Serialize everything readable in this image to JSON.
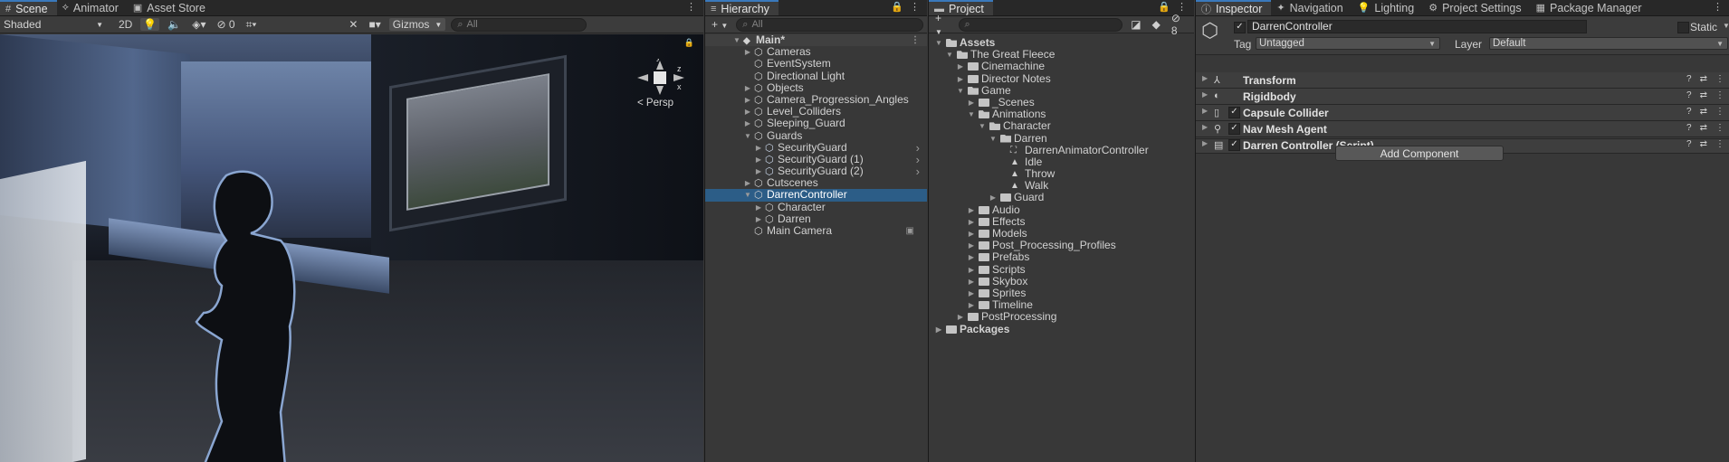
{
  "scene": {
    "tabs": [
      {
        "label": "Scene",
        "icon": "grid-icon"
      },
      {
        "label": "Animator",
        "icon": "animator-icon"
      },
      {
        "label": "Asset Store",
        "icon": "store-icon"
      }
    ],
    "shading_mode": "Shaded",
    "mode_2d": "2D",
    "hidden_count": "0",
    "gizmos_label": "Gizmos",
    "search_placeholder": "All",
    "projection_label": "Persp",
    "gizmo_axes": {
      "y": "y",
      "z": "z",
      "x": "x"
    }
  },
  "hierarchy": {
    "tab_label": "Hierarchy",
    "add_label": "+",
    "search_placeholder": "All",
    "scene_name": "Main*",
    "items": [
      {
        "label": "Cameras",
        "depth": 1,
        "arrow": "closed"
      },
      {
        "label": "EventSystem",
        "depth": 1,
        "arrow": "none"
      },
      {
        "label": "Directional Light",
        "depth": 1,
        "arrow": "none"
      },
      {
        "label": "Objects",
        "depth": 1,
        "arrow": "closed"
      },
      {
        "label": "Camera_Progression_Angles",
        "depth": 1,
        "arrow": "closed"
      },
      {
        "label": "Level_Colliders",
        "depth": 1,
        "arrow": "closed"
      },
      {
        "label": "Sleeping_Guard",
        "depth": 1,
        "arrow": "closed"
      },
      {
        "label": "Guards",
        "depth": 1,
        "arrow": "open"
      },
      {
        "label": "SecurityGuard",
        "depth": 2,
        "arrow": "closed",
        "prefab": true
      },
      {
        "label": "SecurityGuard (1)",
        "depth": 2,
        "arrow": "closed",
        "prefab": true
      },
      {
        "label": "SecurityGuard (2)",
        "depth": 2,
        "arrow": "closed",
        "prefab": true
      },
      {
        "label": "Cutscenes",
        "depth": 1,
        "arrow": "closed"
      },
      {
        "label": "DarrenController",
        "depth": 1,
        "arrow": "open",
        "selected": true
      },
      {
        "label": "Character",
        "depth": 2,
        "arrow": "closed"
      },
      {
        "label": "Darren",
        "depth": 2,
        "arrow": "closed"
      },
      {
        "label": "Main Camera",
        "depth": 1,
        "arrow": "none",
        "badge": "camera-icon"
      }
    ]
  },
  "project": {
    "tab_label": "Project",
    "add_label": "+",
    "hidden_count": "8",
    "items": [
      {
        "label": "Assets",
        "depth": 0,
        "arrow": "open",
        "kind": "folder",
        "bold": true
      },
      {
        "label": "The Great Fleece",
        "depth": 1,
        "arrow": "open",
        "kind": "folder"
      },
      {
        "label": "Cinemachine",
        "depth": 2,
        "arrow": "closed",
        "kind": "folder"
      },
      {
        "label": "Director Notes",
        "depth": 2,
        "arrow": "closed",
        "kind": "folder"
      },
      {
        "label": "Game",
        "depth": 2,
        "arrow": "open",
        "kind": "folder"
      },
      {
        "label": "_Scenes",
        "depth": 3,
        "arrow": "closed",
        "kind": "folder"
      },
      {
        "label": "Animations",
        "depth": 3,
        "arrow": "open",
        "kind": "folder"
      },
      {
        "label": "Character",
        "depth": 4,
        "arrow": "open",
        "kind": "folder"
      },
      {
        "label": "Darren",
        "depth": 5,
        "arrow": "open",
        "kind": "folder"
      },
      {
        "label": "DarrenAnimatorController",
        "depth": 6,
        "arrow": "none",
        "kind": "controller"
      },
      {
        "label": "Idle",
        "depth": 6,
        "arrow": "none",
        "kind": "anim"
      },
      {
        "label": "Throw",
        "depth": 6,
        "arrow": "none",
        "kind": "anim"
      },
      {
        "label": "Walk",
        "depth": 6,
        "arrow": "none",
        "kind": "anim"
      },
      {
        "label": "Guard",
        "depth": 5,
        "arrow": "closed",
        "kind": "folder"
      },
      {
        "label": "Audio",
        "depth": 3,
        "arrow": "closed",
        "kind": "folder"
      },
      {
        "label": "Effects",
        "depth": 3,
        "arrow": "closed",
        "kind": "folder"
      },
      {
        "label": "Models",
        "depth": 3,
        "arrow": "closed",
        "kind": "folder"
      },
      {
        "label": "Post_Processing_Profiles",
        "depth": 3,
        "arrow": "closed",
        "kind": "folder"
      },
      {
        "label": "Prefabs",
        "depth": 3,
        "arrow": "closed",
        "kind": "folder"
      },
      {
        "label": "Scripts",
        "depth": 3,
        "arrow": "closed",
        "kind": "folder"
      },
      {
        "label": "Skybox",
        "depth": 3,
        "arrow": "closed",
        "kind": "folder"
      },
      {
        "label": "Sprites",
        "depth": 3,
        "arrow": "closed",
        "kind": "folder"
      },
      {
        "label": "Timeline",
        "depth": 3,
        "arrow": "closed",
        "kind": "folder"
      },
      {
        "label": "PostProcessing",
        "depth": 2,
        "arrow": "closed",
        "kind": "folder"
      },
      {
        "label": "Packages",
        "depth": 0,
        "arrow": "closed",
        "kind": "folder",
        "bold": true
      }
    ]
  },
  "inspector": {
    "tabs": [
      {
        "label": "Inspector",
        "icon": "info-icon"
      },
      {
        "label": "Navigation",
        "icon": "navigation-icon"
      },
      {
        "label": "Lighting",
        "icon": "lightbulb-icon"
      },
      {
        "label": "Project Settings",
        "icon": "gear-icon"
      },
      {
        "label": "Package Manager",
        "icon": "package-icon"
      }
    ],
    "object_name": "DarrenController",
    "static_label": "Static",
    "tag_label": "Tag",
    "tag_value": "Untagged",
    "layer_label": "Layer",
    "layer_value": "Default",
    "components": [
      {
        "label": "Transform",
        "icon": "transform-icon",
        "checkbox": false
      },
      {
        "label": "Rigidbody",
        "icon": "rigidbody-icon",
        "checkbox": false
      },
      {
        "label": "Capsule Collider",
        "icon": "capsule-collider-icon",
        "checkbox": true
      },
      {
        "label": "Nav Mesh Agent",
        "icon": "nav-mesh-agent-icon",
        "checkbox": true
      },
      {
        "label": "Darren Controller (Script)",
        "icon": "script-icon",
        "checkbox": true
      }
    ],
    "add_component_label": "Add Component"
  },
  "colors": {
    "selection": "#2c5d87",
    "tab_accent": "#3a79bb",
    "panel_bg": "#383838"
  }
}
